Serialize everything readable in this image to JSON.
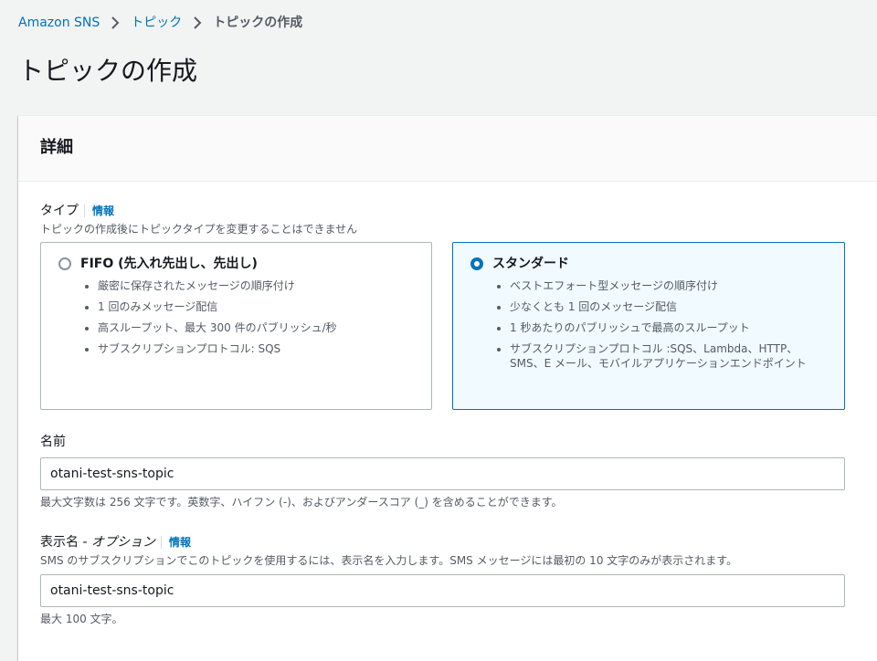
{
  "breadcrumb": {
    "items": [
      "Amazon SNS",
      "トピック"
    ],
    "current": "トピックの作成"
  },
  "page_title": "トピックの作成",
  "details_section": {
    "title": "詳細",
    "type_field": {
      "label": "タイプ",
      "info": "情報",
      "description": "トピックの作成後にトピックタイプを変更することはできません",
      "options": [
        {
          "label": "FIFO (先入れ先出し、先出し)",
          "selected": false,
          "bullets": [
            "厳密に保存されたメッセージの順序付け",
            "1 回のみメッセージ配信",
            "高スループット、最大 300 件のパブリッシュ/秒",
            "サブスクリプションプロトコル: SQS"
          ]
        },
        {
          "label": "スタンダード",
          "selected": true,
          "bullets": [
            "ベストエフォート型メッセージの順序付け",
            "少なくとも 1 回のメッセージ配信",
            "1 秒あたりのパブリッシュで最高のスループット",
            "サブスクリプションプロトコル :SQS、Lambda、HTTP、SMS、E メール、モバイルアプリケーションエンドポイント"
          ]
        }
      ]
    },
    "name_field": {
      "label": "名前",
      "value": "otani-test-sns-topic",
      "hint": "最大文字数は 256 文字です。英数字、ハイフン (-)、およびアンダースコア (_) を含めることができます。"
    },
    "display_name_field": {
      "label": "表示名 -",
      "optional": "オプション",
      "info": "情報",
      "description": "SMS のサブスクリプションでこのトピックを使用するには、表示名を入力します。SMS メッセージには最初の 10 文字のみが表示されます。",
      "value": "otani-test-sns-topic",
      "hint": "最大 100 文字。"
    }
  },
  "colors": {
    "link": "#0073bb",
    "selected_tile_bg": "#f1faff",
    "page_bg": "#f2f3f3"
  }
}
